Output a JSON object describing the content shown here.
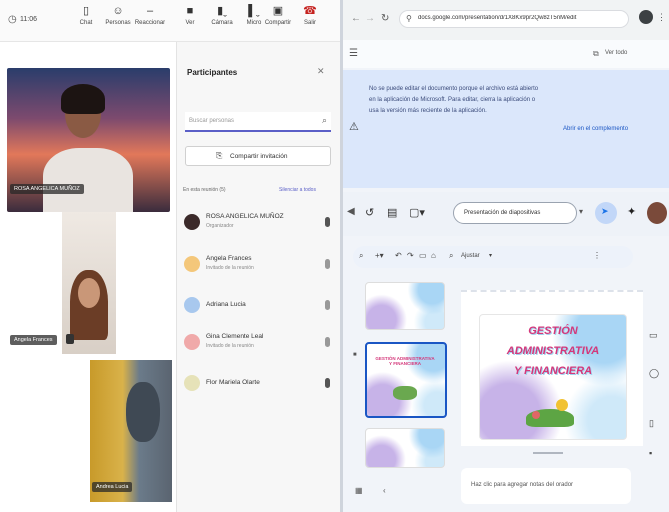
{
  "toolbar": {
    "left_text": "11:06",
    "buttons": [
      {
        "label": "Chat",
        "icon": "chat-icon"
      },
      {
        "label": "Personas",
        "icon": "people-icon"
      },
      {
        "label": "Reaccionar",
        "icon": "smile-icon"
      },
      {
        "label": "Ver",
        "icon": "view-icon"
      },
      {
        "label": "Cámara",
        "icon": "camera-icon"
      },
      {
        "label": "Micro",
        "icon": "mic-icon"
      },
      {
        "label": "Compartir",
        "icon": "share-icon"
      },
      {
        "label": "Salir",
        "icon": "phone-icon"
      }
    ]
  },
  "video_tiles": [
    {
      "label": "ROSA ANGELICA MUÑOZ"
    },
    {
      "label": "Angela Frances"
    },
    {
      "label": "Andrea Lucia"
    }
  ],
  "participants_panel": {
    "title": "Participantes",
    "search_placeholder": "Buscar personas",
    "share_invite": "Compartir invitación",
    "section_label": "En esta reunión (5)",
    "mute_all": "Silenciar a todos",
    "participants": [
      {
        "name": "ROSA ANGELICA MUÑOZ",
        "role": "Organizador",
        "color": "#3b2a2a"
      },
      {
        "name": "Angela Frances",
        "role": "Invitado de la reunión",
        "color": "#e8a23a"
      },
      {
        "name": "Adriana Lucia",
        "role": "",
        "color": "#7aa9e0"
      },
      {
        "name": "Gina Clemente Leal",
        "role": "Invitado de la reunión",
        "color": "#e07a7a"
      },
      {
        "name": "Flor Mariela Olarte",
        "role": "",
        "color": "#d9d4a0"
      }
    ]
  },
  "browser": {
    "url": "docs.google.com/presentation/d/1X8Kx9pr2Qw8zT5nM/edit",
    "update_label": "Ver todo",
    "banner_text": "No se puede editar el documento porque el archivo está abierto en la aplicación de Microsoft. Para editar, cierra la aplicación o usa la versión más reciente de la aplicación.",
    "banner_action": "Abrir en el complemento"
  },
  "slides_toolbar": {
    "slideshow_label": "Presentación de diapositivas",
    "fit_label": "Ajustar"
  },
  "slide": {
    "title_line1": "GESTIÓN",
    "title_line2": "ADMINISTRATIVA",
    "title_line3": "Y FINANCIERA",
    "thumb_title": "GESTIÓN ADMINISTRATIVA Y FINANCIERA",
    "notes_placeholder": "Haz clic para agregar notas del orador"
  },
  "colors": {
    "banner_bg": "#dbe7fb",
    "title_pink": "#d4377a",
    "accent_blue": "#1a73e8"
  }
}
